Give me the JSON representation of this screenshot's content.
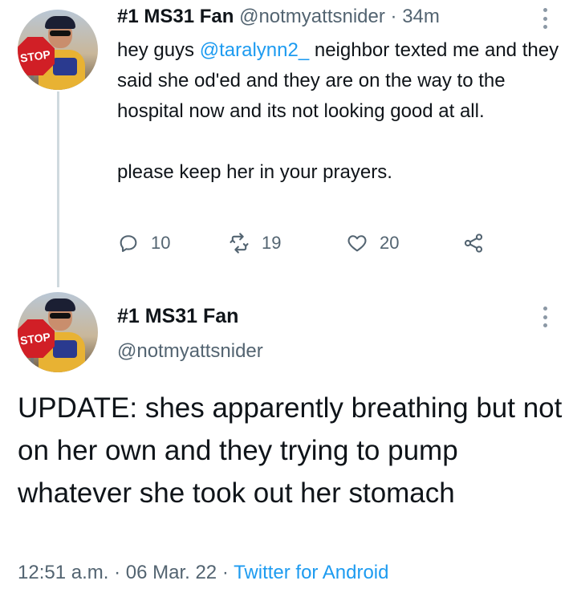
{
  "tweet": {
    "name": "#1 MS31 Fan",
    "handle": "@notmyattsnider",
    "separator": "·",
    "time": "34m",
    "text_before_mention": "hey guys ",
    "mention": "@taralynn2_",
    "text_after_mention": " neighbor texted me and they said she od'ed and they are on the way to the hospital now and its not looking good at all.",
    "text_second_paragraph": "please keep her in your prayers.",
    "avatar_sign": "STOP",
    "actions": {
      "replies": "10",
      "retweets": "19",
      "likes": "20"
    }
  },
  "reply": {
    "name": "#1 MS31 Fan",
    "handle": "@notmyattsnider",
    "avatar_sign": "STOP",
    "text": "UPDATE: shes apparently breathing but not on her own and they trying to pump whatever she took out her stomach",
    "time": "12:51 a.m.",
    "separator": "·",
    "date": "06 Mar. 22",
    "separator2": "·",
    "source": "Twitter for Android"
  },
  "colors": {
    "link": "#1d9bf0",
    "secondary_text": "#536471",
    "thread_line": "#cfd9de"
  },
  "icons": [
    "more-options-icon",
    "reply-icon",
    "retweet-icon",
    "like-icon",
    "share-icon"
  ]
}
